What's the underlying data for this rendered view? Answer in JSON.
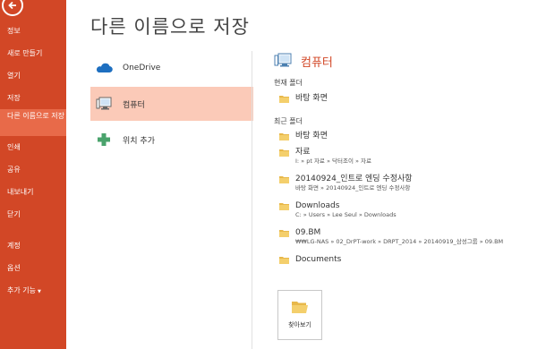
{
  "sidebar": {
    "items": [
      {
        "label": "정보",
        "active": false
      },
      {
        "label": "새로 만들기",
        "active": false
      },
      {
        "label": "열기",
        "active": false
      },
      {
        "label": "저장",
        "active": false
      },
      {
        "label": "다른 이름으로 저장",
        "active": true
      },
      {
        "label": "인쇄",
        "active": false
      },
      {
        "label": "공유",
        "active": false
      },
      {
        "label": "내보내기",
        "active": false
      },
      {
        "label": "닫기",
        "active": false
      }
    ],
    "bottom_items": [
      {
        "label": "계정"
      },
      {
        "label": "옵션"
      },
      {
        "label": "추가 기능",
        "has_caret": true
      }
    ]
  },
  "page_title": "다른 이름으로 저장",
  "locations": [
    {
      "label": "OneDrive",
      "icon": "cloud-icon",
      "selected": false
    },
    {
      "label": "컴퓨터",
      "icon": "computer-icon",
      "selected": true
    },
    {
      "label": "위치 추가",
      "icon": "plus-icon",
      "selected": false
    }
  ],
  "panel": {
    "title": "컴퓨터",
    "current_folder_label": "현재 폴더",
    "current_folder": {
      "name": "바탕 화면"
    },
    "recent_folders_label": "최근 폴더",
    "recent_folders": [
      {
        "name": "바탕 화면",
        "path": ""
      },
      {
        "name": "자료",
        "path": "I: » pt 자료 » 닥터조이 » 자료"
      },
      {
        "name": "20140924_인트로 엔딩 수정사항",
        "path": "바탕 화면 » 20140924_인트로 엔딩 수정사항"
      },
      {
        "name": "Downloads",
        "path": "C: » Users » Lee Seul » Downloads"
      },
      {
        "name": "09.BM",
        "path": "₩₩LG-NAS » 02_DrPT-work » DRPT_2014 » 20140919_삼성그룹 » 09.BM"
      },
      {
        "name": "Documents",
        "path": ""
      }
    ],
    "browse_label": "찾아보기"
  },
  "colors": {
    "accent": "#d24726",
    "accent_light": "#e86a49",
    "selection": "#fbcab8",
    "onedrive": "#1e6fc0",
    "plus": "#4aa36c",
    "folder": "#e8b84a"
  }
}
